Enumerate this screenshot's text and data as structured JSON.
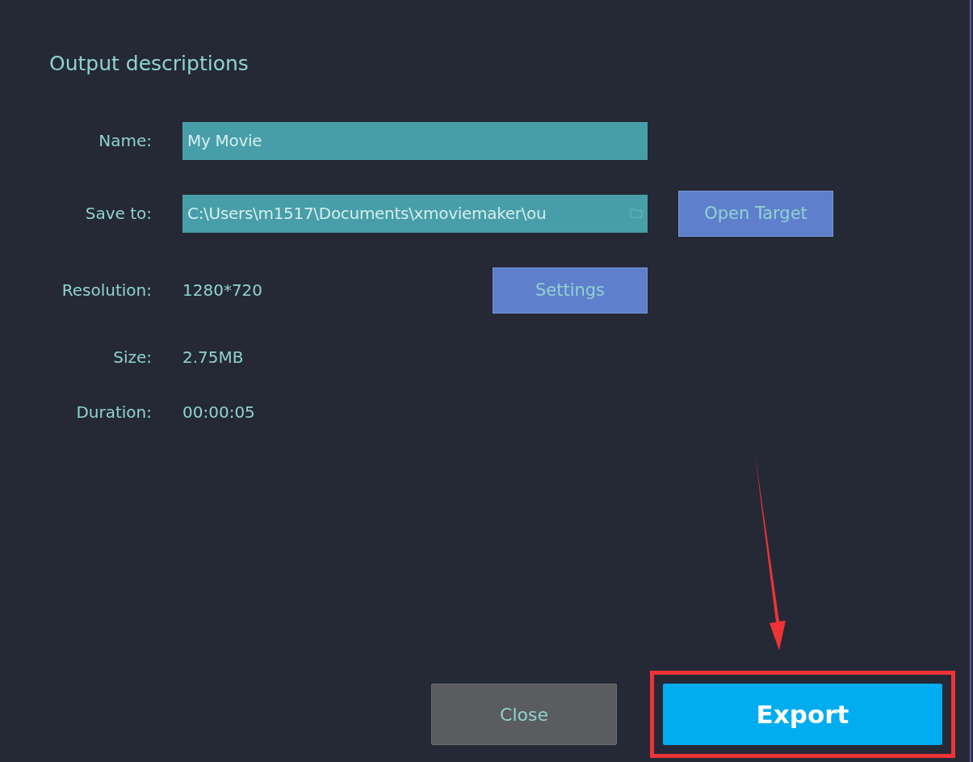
{
  "title": "Output descriptions",
  "rows": [
    {
      "kind": "input",
      "label": "Name:",
      "value": "My Movie"
    },
    {
      "kind": "path",
      "label": "Save to:",
      "value": "C:\\Users\\m1517\\Documents\\xmoviemaker\\ou",
      "button": "Open Target"
    },
    {
      "kind": "setting",
      "label": "Resolution:",
      "value": "1280*720",
      "button": "Settings"
    },
    {
      "kind": "text",
      "label": "Size:",
      "value": "2.75MB"
    },
    {
      "kind": "text",
      "label": "Duration:",
      "value": "00:00:05"
    }
  ],
  "buttons": [
    {
      "kind": "secondary",
      "label": "Close",
      "highlighted": false
    },
    {
      "kind": "primary",
      "label": "Export",
      "highlighted": true
    }
  ]
}
